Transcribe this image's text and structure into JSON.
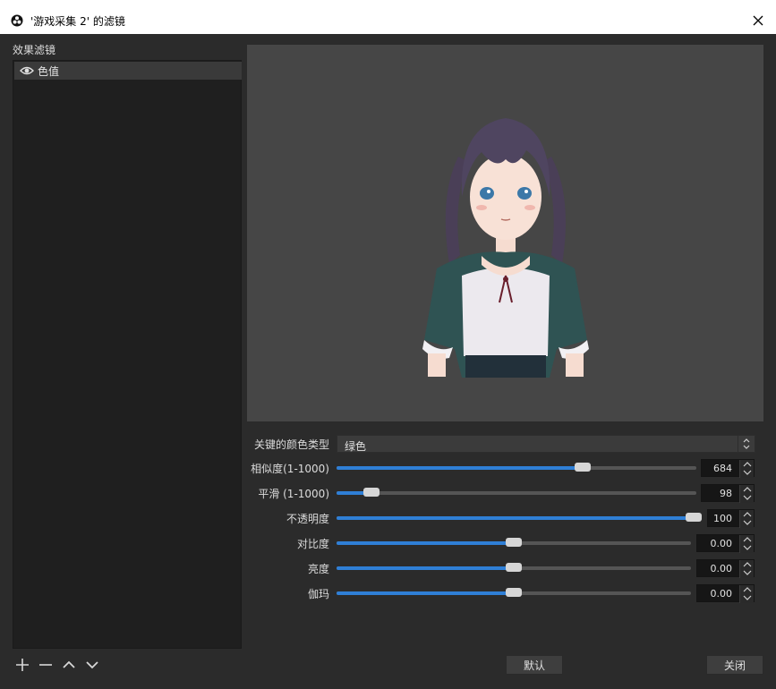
{
  "window": {
    "title": "'游戏采集 2' 的滤镜"
  },
  "filters": {
    "heading": "效果滤镜",
    "items": [
      {
        "label": "色值",
        "visible": true
      }
    ]
  },
  "bottom_toolbar": {
    "add_icon": "plus-icon",
    "remove_icon": "minus-icon",
    "up_icon": "chevron-up-icon",
    "down_icon": "chevron-down-icon"
  },
  "properties": {
    "key_color_type": {
      "label": "关键的颜色类型",
      "value": "绿色"
    },
    "similarity": {
      "label": "相似度(1-1000)",
      "value": "684",
      "fraction": 0.684
    },
    "smoothness": {
      "label": "平滑 (1-1000)",
      "value": "98",
      "fraction": 0.098
    },
    "opacity": {
      "label": "不透明度",
      "value": "100",
      "fraction": 1.0
    },
    "contrast": {
      "label": "对比度",
      "value": "0.00",
      "fraction": 0.5
    },
    "brightness": {
      "label": "亮度",
      "value": "0.00",
      "fraction": 0.5
    },
    "gamma": {
      "label": "伽玛",
      "value": "0.00",
      "fraction": 0.5
    }
  },
  "buttons": {
    "defaults": "默认",
    "close": "关闭"
  },
  "colors": {
    "accent": "#2f7fd6",
    "panel": "#2b2b2b",
    "preview": "#464646"
  }
}
